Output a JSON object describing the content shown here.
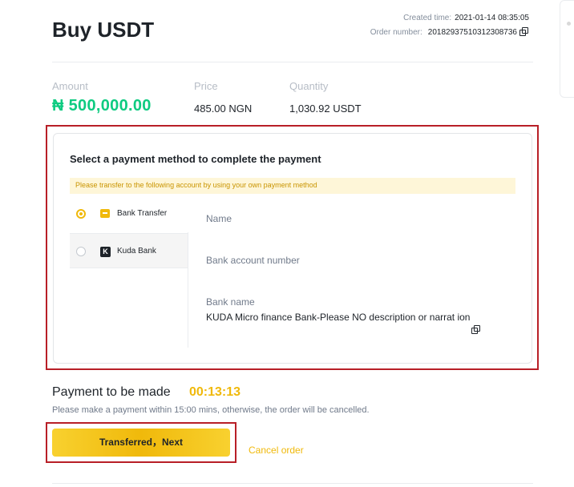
{
  "header": {
    "title": "Buy USDT",
    "created_label": "Created time:",
    "created_value": "2021-01-14 08:35:05",
    "order_label": "Order number:",
    "order_value": "20182937510312308736"
  },
  "summary": {
    "amount_label": "Amount",
    "amount_value": "₦ 500,000.00",
    "price_label": "Price",
    "price_value": "485.00 NGN",
    "quantity_label": "Quantity",
    "quantity_value": "1,030.92 USDT"
  },
  "payment": {
    "title": "Select a payment method to complete the payment",
    "notice": "Please transfer to the following account by using your own payment method",
    "methods": [
      {
        "label": "Bank Transfer",
        "selected": true,
        "icon": "bank-card-icon"
      },
      {
        "label": "Kuda Bank",
        "selected": false,
        "icon": "kuda-logo-icon"
      }
    ],
    "fields": {
      "name_label": "Name",
      "account_label": "Bank account number",
      "bank_label": "Bank name",
      "bank_value": "KUDA Micro finance Bank-Please NO description or narrat ion"
    }
  },
  "timer": {
    "label": "Payment to be made",
    "countdown": "00:13:13",
    "note": "Please make a payment within 15:00 mins, otherwise, the order will be cancelled."
  },
  "actions": {
    "next_label": "Transferred，Next",
    "cancel_label": "Cancel order"
  },
  "colors": {
    "accent": "#f0b90b",
    "amount_green": "#0ecb81",
    "highlight_red": "#b81f27"
  }
}
